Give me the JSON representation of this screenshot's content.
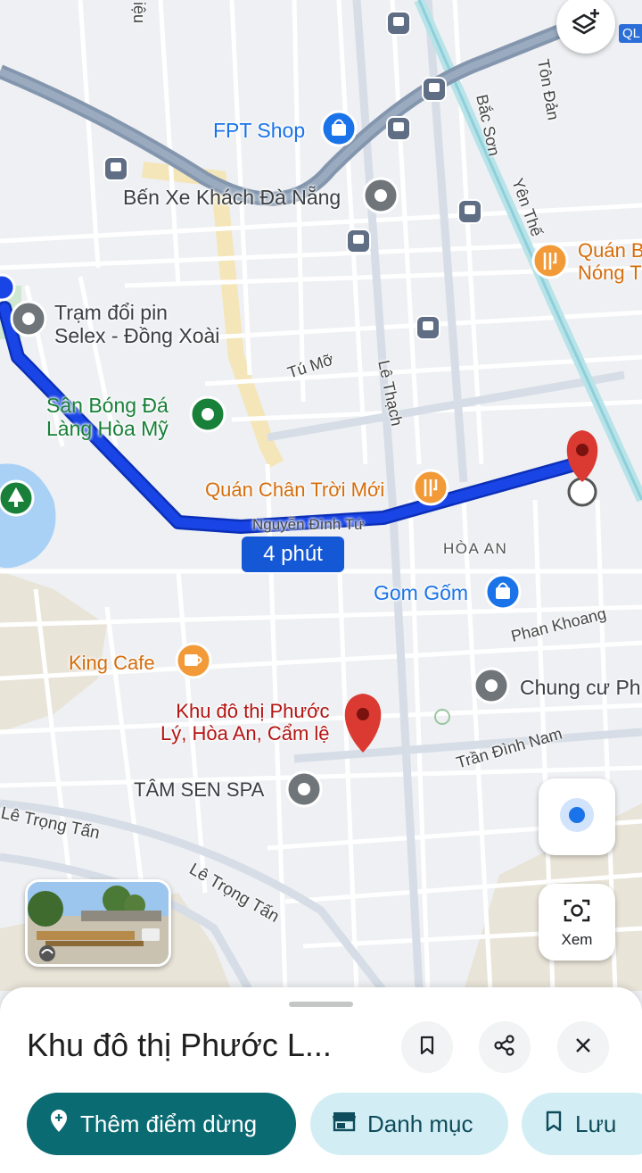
{
  "map": {
    "eta_label": "4 phút",
    "route_color": "#1a45e6",
    "pois": [
      {
        "name": "FPT Shop",
        "type": "shopping"
      },
      {
        "name": "Bến Xe Khách Đà Nẵng",
        "type": "transit-station"
      },
      {
        "name": "Trạm đổi pin\nSelex - Đồng Xoài",
        "type": "place"
      },
      {
        "name": "Sân Bóng Đá\nLàng Hòa Mỹ",
        "type": "sports"
      },
      {
        "name": "Quán Chân Trời Mới",
        "type": "restaurant"
      },
      {
        "name": "Quán B\nNóng T",
        "type": "restaurant"
      },
      {
        "name": "Gom Gốm",
        "type": "shopping"
      },
      {
        "name": "King Cafe",
        "type": "cafe"
      },
      {
        "name": "Khu đô thị Phước\nLý, Hòa An, Cẩm lệ",
        "type": "selected-place"
      },
      {
        "name": "Chung cư Ph",
        "type": "place"
      },
      {
        "name": "TÂM SEN SPA",
        "type": "place"
      }
    ],
    "streets": {
      "to_mo": "Tú Mỡ",
      "le_thach": "Lê Thạch",
      "nguyen_dinh_tu": "Nguyễn Đình Tứ",
      "bac_son": "Bắc Sơn",
      "yen_the": "Yên Thế",
      "ton_dan": "Tôn Đản",
      "phan_khoang": "Phan Khoang",
      "tran_dinh_nam": "Trần Đình Nam",
      "le_trong_tan_1": "Lê Trọng Tấn",
      "le_trong_tan_2": "Lê Trọng Tấn",
      "edge_top": "iệu",
      "highway_badge": "QL"
    },
    "area_label": "HÒA AN"
  },
  "controls": {
    "layers_icon": "layers-plus-icon",
    "my_location_icon": "my-location-icon",
    "lens_label": "Xem"
  },
  "sheet": {
    "title": "Khu đô thị Phước L...",
    "buttons": [
      {
        "label": "Thêm điểm dừng",
        "icon": "add-stop-pin-icon"
      },
      {
        "label": "Danh mục",
        "icon": "storefront-icon"
      },
      {
        "label": "Lưu",
        "icon": "bookmark-icon"
      }
    ]
  }
}
